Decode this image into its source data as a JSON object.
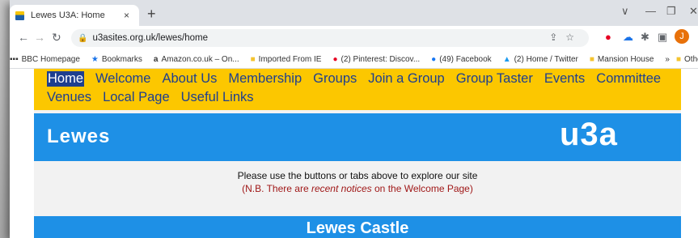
{
  "browser": {
    "tab_title": "Lewes U3A: Home",
    "tab_close": "×",
    "new_tab": "+",
    "url": "u3asites.org.uk/lewes/home",
    "bookmarks": [
      {
        "label": "BBC Homepage",
        "icon": "grid-icon"
      },
      {
        "label": "Bookmarks",
        "icon": "star-icon"
      },
      {
        "label": "Amazon.co.uk – On...",
        "icon": "amazon-icon"
      },
      {
        "label": "Imported From IE",
        "icon": "folder-icon"
      },
      {
        "label": "(2) Pinterest: Discov...",
        "icon": "pinterest-icon"
      },
      {
        "label": "(49) Facebook",
        "icon": "facebook-icon"
      },
      {
        "label": "(2) Home / Twitter",
        "icon": "twitter-icon"
      },
      {
        "label": "Mansion House",
        "icon": "folder-icon"
      }
    ],
    "bookmarks_overflow": "»",
    "other_bookmarks": "Other bookmarks",
    "profile_initial": "J"
  },
  "site": {
    "menu_row1": [
      "Home",
      "Welcome",
      "About Us",
      "Membership",
      "Groups",
      "Join a Group",
      "Group Taster",
      "Events",
      "Committee"
    ],
    "menu_row2": [
      "Venues",
      "Local Page",
      "Useful Links"
    ],
    "banner_name": "Lewes",
    "logo": "u3a",
    "notice_line1": "Please use the buttons or tabs above to explore our site",
    "notice_line2_pre": "(N.B. There are ",
    "notice_line2_em": "recent notices",
    "notice_line2_post": " on the Welcome Page)",
    "section_title": "Lewes Castle"
  },
  "colors": {
    "menu_bg": "#fcc700",
    "link": "#1e3f8f",
    "banner": "#1e90e6",
    "notice_red": "#a01818"
  }
}
